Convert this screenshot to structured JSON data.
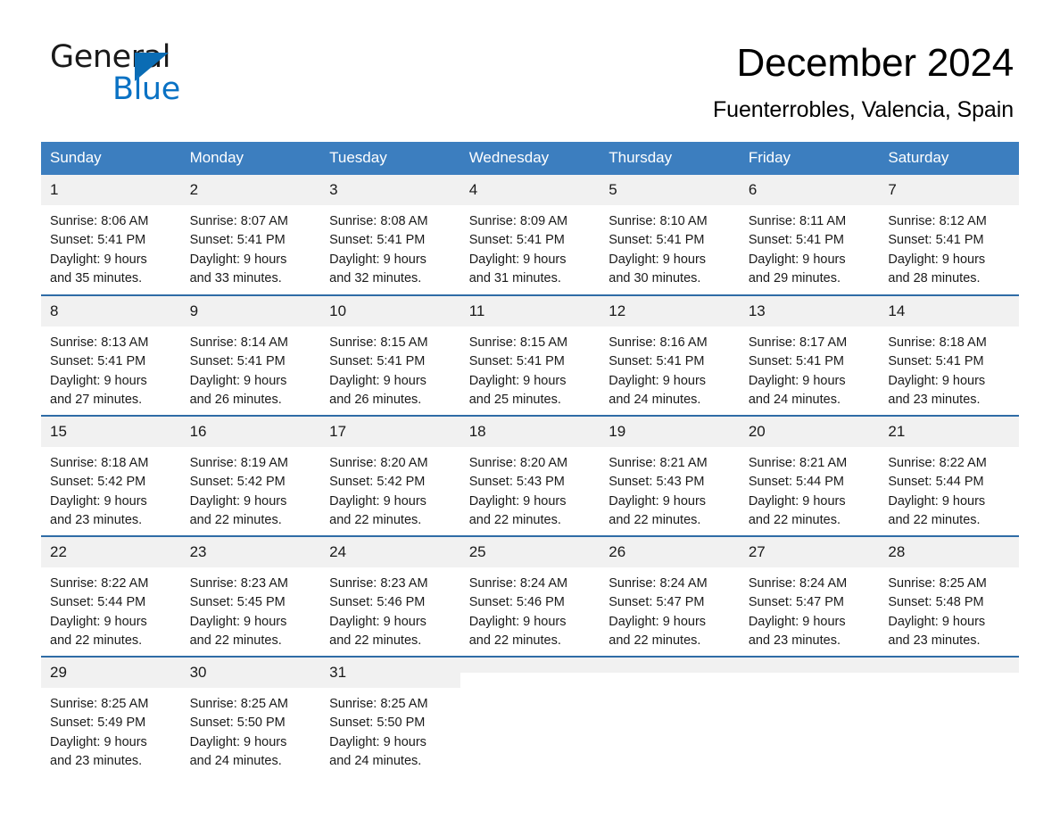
{
  "brand": {
    "name_dark": "General",
    "name_blue": "Blue",
    "triangle_color": "#0a6cb4",
    "blue_color": "#0a72c4"
  },
  "header": {
    "title": "December 2024",
    "subtitle": "Fuenterrobles, Valencia, Spain"
  },
  "theme": {
    "header_bg": "#3c7ebf",
    "row_rule": "#2f6ca6",
    "daynum_bg": "#f1f1f1"
  },
  "weekday_headers": [
    "Sunday",
    "Monday",
    "Tuesday",
    "Wednesday",
    "Thursday",
    "Friday",
    "Saturday"
  ],
  "weeks": [
    [
      {
        "day": "1",
        "sunrise": "Sunrise: 8:06 AM",
        "sunset": "Sunset: 5:41 PM",
        "daylight1": "Daylight: 9 hours",
        "daylight2": "and 35 minutes."
      },
      {
        "day": "2",
        "sunrise": "Sunrise: 8:07 AM",
        "sunset": "Sunset: 5:41 PM",
        "daylight1": "Daylight: 9 hours",
        "daylight2": "and 33 minutes."
      },
      {
        "day": "3",
        "sunrise": "Sunrise: 8:08 AM",
        "sunset": "Sunset: 5:41 PM",
        "daylight1": "Daylight: 9 hours",
        "daylight2": "and 32 minutes."
      },
      {
        "day": "4",
        "sunrise": "Sunrise: 8:09 AM",
        "sunset": "Sunset: 5:41 PM",
        "daylight1": "Daylight: 9 hours",
        "daylight2": "and 31 minutes."
      },
      {
        "day": "5",
        "sunrise": "Sunrise: 8:10 AM",
        "sunset": "Sunset: 5:41 PM",
        "daylight1": "Daylight: 9 hours",
        "daylight2": "and 30 minutes."
      },
      {
        "day": "6",
        "sunrise": "Sunrise: 8:11 AM",
        "sunset": "Sunset: 5:41 PM",
        "daylight1": "Daylight: 9 hours",
        "daylight2": "and 29 minutes."
      },
      {
        "day": "7",
        "sunrise": "Sunrise: 8:12 AM",
        "sunset": "Sunset: 5:41 PM",
        "daylight1": "Daylight: 9 hours",
        "daylight2": "and 28 minutes."
      }
    ],
    [
      {
        "day": "8",
        "sunrise": "Sunrise: 8:13 AM",
        "sunset": "Sunset: 5:41 PM",
        "daylight1": "Daylight: 9 hours",
        "daylight2": "and 27 minutes."
      },
      {
        "day": "9",
        "sunrise": "Sunrise: 8:14 AM",
        "sunset": "Sunset: 5:41 PM",
        "daylight1": "Daylight: 9 hours",
        "daylight2": "and 26 minutes."
      },
      {
        "day": "10",
        "sunrise": "Sunrise: 8:15 AM",
        "sunset": "Sunset: 5:41 PM",
        "daylight1": "Daylight: 9 hours",
        "daylight2": "and 26 minutes."
      },
      {
        "day": "11",
        "sunrise": "Sunrise: 8:15 AM",
        "sunset": "Sunset: 5:41 PM",
        "daylight1": "Daylight: 9 hours",
        "daylight2": "and 25 minutes."
      },
      {
        "day": "12",
        "sunrise": "Sunrise: 8:16 AM",
        "sunset": "Sunset: 5:41 PM",
        "daylight1": "Daylight: 9 hours",
        "daylight2": "and 24 minutes."
      },
      {
        "day": "13",
        "sunrise": "Sunrise: 8:17 AM",
        "sunset": "Sunset: 5:41 PM",
        "daylight1": "Daylight: 9 hours",
        "daylight2": "and 24 minutes."
      },
      {
        "day": "14",
        "sunrise": "Sunrise: 8:18 AM",
        "sunset": "Sunset: 5:41 PM",
        "daylight1": "Daylight: 9 hours",
        "daylight2": "and 23 minutes."
      }
    ],
    [
      {
        "day": "15",
        "sunrise": "Sunrise: 8:18 AM",
        "sunset": "Sunset: 5:42 PM",
        "daylight1": "Daylight: 9 hours",
        "daylight2": "and 23 minutes."
      },
      {
        "day": "16",
        "sunrise": "Sunrise: 8:19 AM",
        "sunset": "Sunset: 5:42 PM",
        "daylight1": "Daylight: 9 hours",
        "daylight2": "and 22 minutes."
      },
      {
        "day": "17",
        "sunrise": "Sunrise: 8:20 AM",
        "sunset": "Sunset: 5:42 PM",
        "daylight1": "Daylight: 9 hours",
        "daylight2": "and 22 minutes."
      },
      {
        "day": "18",
        "sunrise": "Sunrise: 8:20 AM",
        "sunset": "Sunset: 5:43 PM",
        "daylight1": "Daylight: 9 hours",
        "daylight2": "and 22 minutes."
      },
      {
        "day": "19",
        "sunrise": "Sunrise: 8:21 AM",
        "sunset": "Sunset: 5:43 PM",
        "daylight1": "Daylight: 9 hours",
        "daylight2": "and 22 minutes."
      },
      {
        "day": "20",
        "sunrise": "Sunrise: 8:21 AM",
        "sunset": "Sunset: 5:44 PM",
        "daylight1": "Daylight: 9 hours",
        "daylight2": "and 22 minutes."
      },
      {
        "day": "21",
        "sunrise": "Sunrise: 8:22 AM",
        "sunset": "Sunset: 5:44 PM",
        "daylight1": "Daylight: 9 hours",
        "daylight2": "and 22 minutes."
      }
    ],
    [
      {
        "day": "22",
        "sunrise": "Sunrise: 8:22 AM",
        "sunset": "Sunset: 5:44 PM",
        "daylight1": "Daylight: 9 hours",
        "daylight2": "and 22 minutes."
      },
      {
        "day": "23",
        "sunrise": "Sunrise: 8:23 AM",
        "sunset": "Sunset: 5:45 PM",
        "daylight1": "Daylight: 9 hours",
        "daylight2": "and 22 minutes."
      },
      {
        "day": "24",
        "sunrise": "Sunrise: 8:23 AM",
        "sunset": "Sunset: 5:46 PM",
        "daylight1": "Daylight: 9 hours",
        "daylight2": "and 22 minutes."
      },
      {
        "day": "25",
        "sunrise": "Sunrise: 8:24 AM",
        "sunset": "Sunset: 5:46 PM",
        "daylight1": "Daylight: 9 hours",
        "daylight2": "and 22 minutes."
      },
      {
        "day": "26",
        "sunrise": "Sunrise: 8:24 AM",
        "sunset": "Sunset: 5:47 PM",
        "daylight1": "Daylight: 9 hours",
        "daylight2": "and 22 minutes."
      },
      {
        "day": "27",
        "sunrise": "Sunrise: 8:24 AM",
        "sunset": "Sunset: 5:47 PM",
        "daylight1": "Daylight: 9 hours",
        "daylight2": "and 23 minutes."
      },
      {
        "day": "28",
        "sunrise": "Sunrise: 8:25 AM",
        "sunset": "Sunset: 5:48 PM",
        "daylight1": "Daylight: 9 hours",
        "daylight2": "and 23 minutes."
      }
    ],
    [
      {
        "day": "29",
        "sunrise": "Sunrise: 8:25 AM",
        "sunset": "Sunset: 5:49 PM",
        "daylight1": "Daylight: 9 hours",
        "daylight2": "and 23 minutes."
      },
      {
        "day": "30",
        "sunrise": "Sunrise: 8:25 AM",
        "sunset": "Sunset: 5:50 PM",
        "daylight1": "Daylight: 9 hours",
        "daylight2": "and 24 minutes."
      },
      {
        "day": "31",
        "sunrise": "Sunrise: 8:25 AM",
        "sunset": "Sunset: 5:50 PM",
        "daylight1": "Daylight: 9 hours",
        "daylight2": "and 24 minutes."
      },
      {
        "day": "",
        "sunrise": "",
        "sunset": "",
        "daylight1": "",
        "daylight2": ""
      },
      {
        "day": "",
        "sunrise": "",
        "sunset": "",
        "daylight1": "",
        "daylight2": ""
      },
      {
        "day": "",
        "sunrise": "",
        "sunset": "",
        "daylight1": "",
        "daylight2": ""
      },
      {
        "day": "",
        "sunrise": "",
        "sunset": "",
        "daylight1": "",
        "daylight2": ""
      }
    ]
  ]
}
